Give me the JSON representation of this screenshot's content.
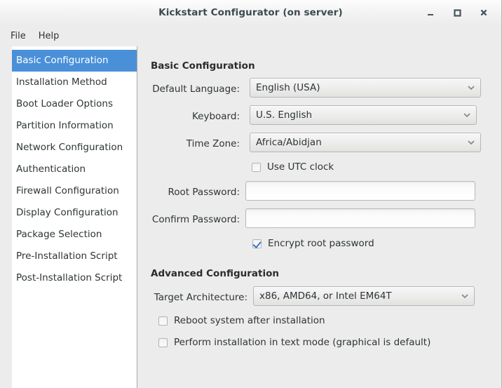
{
  "window": {
    "title": "Kickstart Configurator (on server)",
    "controls": [
      {
        "name": "minimize",
        "glyph": "minimize-icon"
      },
      {
        "name": "maximize",
        "glyph": "maximize-icon"
      },
      {
        "name": "close",
        "glyph": "close-icon"
      }
    ]
  },
  "menubar": {
    "items": [
      {
        "label": "File"
      },
      {
        "label": "Help"
      }
    ]
  },
  "sidebar": {
    "items": [
      {
        "label": "Basic Configuration",
        "selected": true
      },
      {
        "label": "Installation Method",
        "selected": false
      },
      {
        "label": "Boot Loader Options",
        "selected": false
      },
      {
        "label": "Partition Information",
        "selected": false
      },
      {
        "label": "Network Configuration",
        "selected": false
      },
      {
        "label": "Authentication",
        "selected": false
      },
      {
        "label": "Firewall Configuration",
        "selected": false
      },
      {
        "label": "Display Configuration",
        "selected": false
      },
      {
        "label": "Package Selection",
        "selected": false
      },
      {
        "label": "Pre-Installation Script",
        "selected": false
      },
      {
        "label": "Post-Installation Script",
        "selected": false
      }
    ]
  },
  "main": {
    "basic": {
      "heading": "Basic Configuration",
      "default_language": {
        "label": "Default Language:",
        "value": "English (USA)"
      },
      "keyboard": {
        "label": "Keyboard:",
        "value": "U.S. English"
      },
      "timezone": {
        "label": "Time Zone:",
        "value": "Africa/Abidjan"
      },
      "use_utc": {
        "label": "Use UTC clock",
        "checked": false
      },
      "root_password": {
        "label": "Root Password:",
        "value": "",
        "placeholder": ""
      },
      "confirm_password": {
        "label": "Confirm Password:",
        "value": "",
        "placeholder": ""
      },
      "encrypt_root": {
        "label": "Encrypt root password",
        "checked": true
      }
    },
    "advanced": {
      "heading": "Advanced Configuration",
      "target_architecture": {
        "label": "Target Architecture:",
        "value": "x86, AMD64, or Intel EM64T"
      },
      "reboot_after": {
        "label": "Reboot system after installation",
        "checked": false
      },
      "text_mode": {
        "label": "Perform installation in text mode (graphical is default)",
        "checked": false
      }
    }
  },
  "colors": {
    "selection": "#4a90d9",
    "window_bg": "#ececec",
    "sidebar_bg": "#ffffff",
    "text": "#2e3436",
    "check_accent": "#3a76c4"
  }
}
